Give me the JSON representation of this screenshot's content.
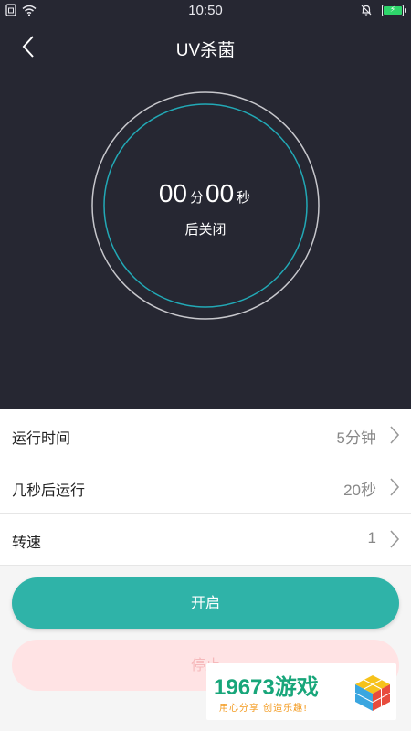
{
  "status_bar": {
    "time": "10:50",
    "battery_color": "#2ed66b"
  },
  "header": {
    "title": "UV杀菌",
    "back_icon": "chevron-left-icon"
  },
  "timer": {
    "minutes": "00",
    "minutes_unit": "分",
    "seconds": "00",
    "seconds_unit": "秒",
    "suffix": "后关闭"
  },
  "settings": [
    {
      "label": "运行时间",
      "value": "5分钟"
    },
    {
      "label": "几秒后运行",
      "value": "20秒"
    },
    {
      "label": "转速",
      "value": "1"
    }
  ],
  "buttons": {
    "start_label": "开启",
    "stop_label": "停止"
  },
  "watermark": {
    "brand": "19673游戏",
    "tagline": "用心分享 创造乐趣!"
  },
  "colors": {
    "header_bg": "#262732",
    "accent_teal": "#2fb3a8",
    "stop_bg": "#ffe3e4"
  }
}
